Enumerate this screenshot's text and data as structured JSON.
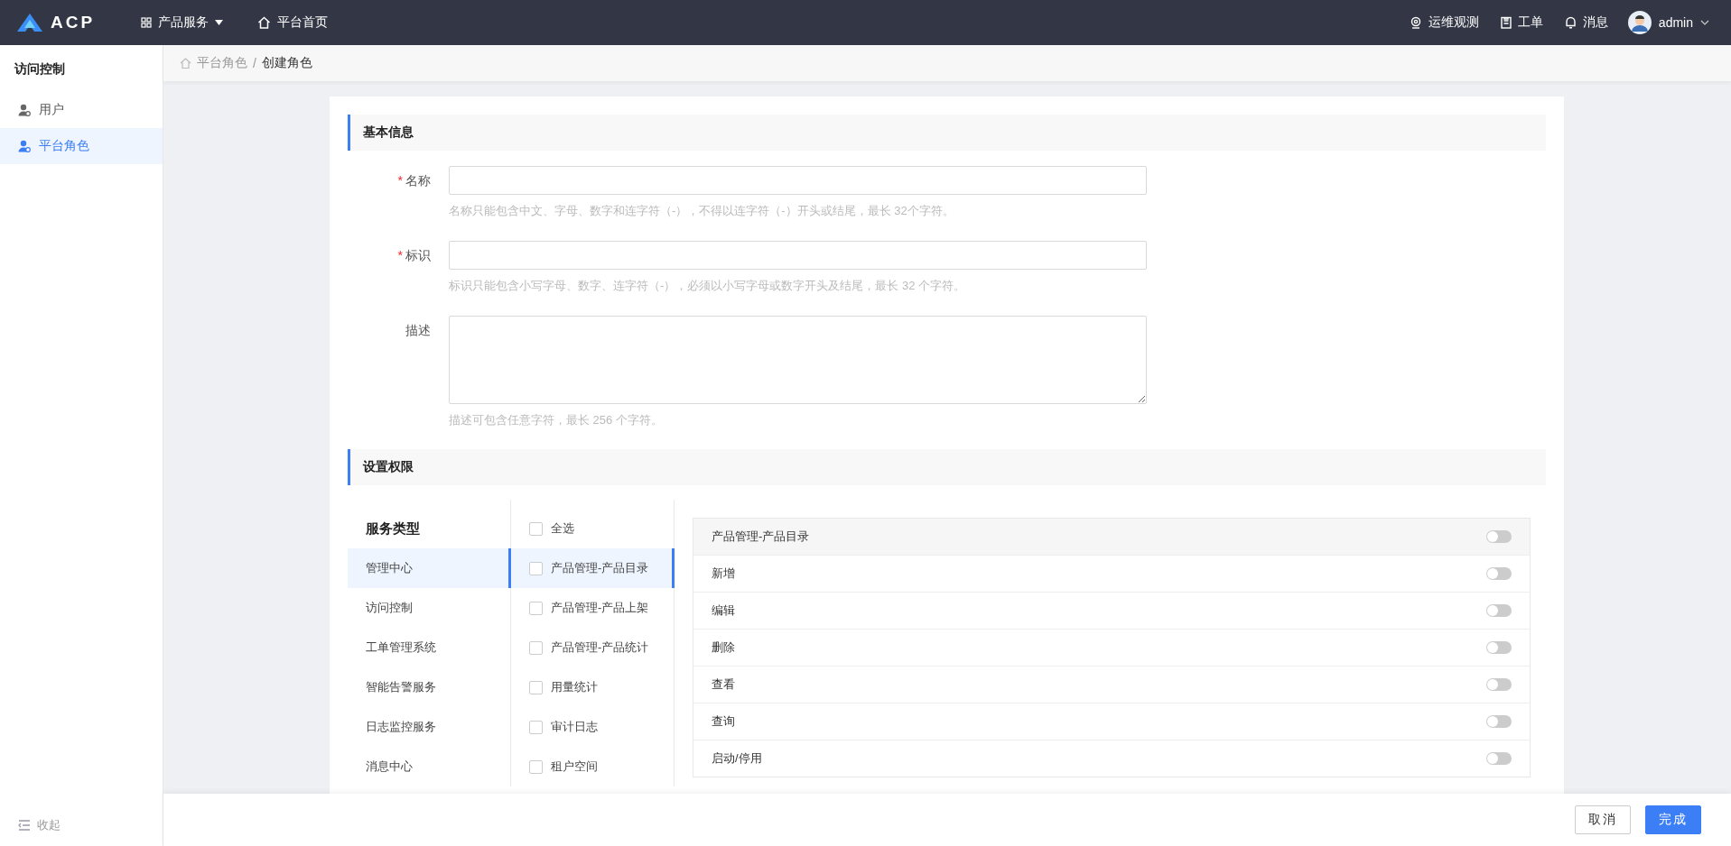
{
  "topbar": {
    "logo": "ACP",
    "menu": [
      {
        "label": "产品服务",
        "kind": "dropdown"
      },
      {
        "label": "平台首页",
        "kind": "home"
      }
    ],
    "actions": [
      {
        "label": "运维观测",
        "kind": "monitor"
      },
      {
        "label": "工单",
        "kind": "doc"
      },
      {
        "label": "消息",
        "kind": "bell"
      }
    ],
    "user": "admin"
  },
  "sidebar": {
    "title": "访问控制",
    "items": [
      {
        "label": "用户",
        "selected": false
      },
      {
        "label": "平台角色",
        "selected": true
      }
    ],
    "collapse": "收起"
  },
  "breadcrumb": {
    "separator": "/",
    "items": [
      "平台角色",
      "创建角色"
    ]
  },
  "basic": {
    "title": "基本信息",
    "fields": [
      {
        "label": "名称",
        "required_mark": "*",
        "kind": "input",
        "hint": "名称只能包含中文、字母、数字和连字符（-），不得以连字符（-）开头或结尾，最长 32个字符。"
      },
      {
        "label": "标识",
        "required_mark": "*",
        "kind": "input",
        "hint": "标识只能包含小写字母、数字、连字符（-），必须以小写字母或数字开头及结尾，最长 32 个字符。"
      },
      {
        "label": "描述",
        "kind": "textarea",
        "hint": "描述可包含任意字符，最长 256 个字符。"
      }
    ]
  },
  "permissions": {
    "title": "设置权限",
    "services_title": "服务类型",
    "services": [
      {
        "label": "管理中心",
        "selected": true
      },
      {
        "label": "访问控制",
        "selected": false
      },
      {
        "label": "工单管理系统",
        "selected": false
      },
      {
        "label": "智能告警服务",
        "selected": false
      },
      {
        "label": "日志监控服务",
        "selected": false
      },
      {
        "label": "消息中心",
        "selected": false
      }
    ],
    "modules": [
      {
        "label": "全选",
        "checked": false,
        "selected": false
      },
      {
        "label": "产品管理-产品目录",
        "checked": false,
        "selected": true
      },
      {
        "label": "产品管理-产品上架",
        "checked": false,
        "selected": false
      },
      {
        "label": "产品管理-产品统计",
        "checked": false,
        "selected": false
      },
      {
        "label": "用量统计",
        "checked": false,
        "selected": false
      },
      {
        "label": "审计日志",
        "checked": false,
        "selected": false
      },
      {
        "label": "租户空间",
        "checked": false,
        "selected": false
      }
    ],
    "actions": [
      {
        "label": "产品管理-产品目录",
        "kind": "header",
        "on": false
      },
      {
        "label": "新增",
        "kind": "row",
        "on": false
      },
      {
        "label": "编辑",
        "kind": "row",
        "on": false
      },
      {
        "label": "删除",
        "kind": "row",
        "on": false
      },
      {
        "label": "查看",
        "kind": "row",
        "on": false
      },
      {
        "label": "查询",
        "kind": "row",
        "on": false
      },
      {
        "label": "启动/停用",
        "kind": "row",
        "on": false
      }
    ]
  },
  "footer": {
    "buttons": [
      {
        "label": "取消",
        "kind": "secondary"
      },
      {
        "label": "完成",
        "kind": "primary"
      }
    ]
  }
}
